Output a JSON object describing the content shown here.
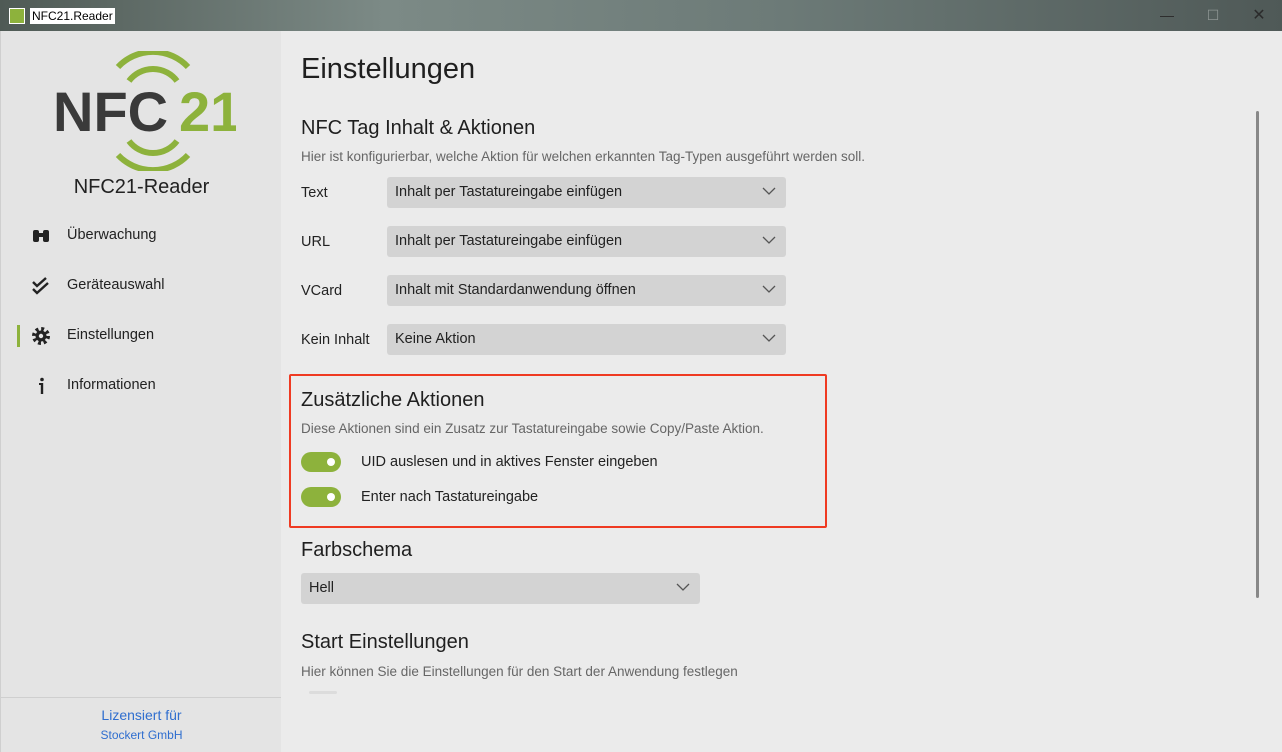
{
  "window": {
    "title": "NFC21.Reader",
    "controls": {
      "minimize": "—",
      "maximize": "☐",
      "close": "✕"
    }
  },
  "sidebar": {
    "logo_text": {
      "nfc": "NFC",
      "num": "21"
    },
    "app_name": "NFC21-Reader",
    "items": [
      {
        "label": "Überwachung",
        "icon": "binoculars-icon",
        "active": false
      },
      {
        "label": "Geräteauswahl",
        "icon": "double-check-icon",
        "active": false
      },
      {
        "label": "Einstellungen",
        "icon": "gear-icon",
        "active": true
      },
      {
        "label": "Informationen",
        "icon": "info-icon",
        "active": false
      }
    ],
    "license_line1": "Lizensiert für",
    "license_line2": "Stockert GmbH"
  },
  "main": {
    "title": "Einstellungen",
    "nfc_section": {
      "title": "NFC Tag Inhalt & Aktionen",
      "description": "Hier ist konfigurierbar, welche Aktion für welchen erkannten Tag-Typen ausgeführt werden soll.",
      "rows": [
        {
          "label": "Text",
          "value": "Inhalt per Tastatureingabe einfügen"
        },
        {
          "label": "URL",
          "value": "Inhalt per Tastatureingabe einfügen"
        },
        {
          "label": "VCard",
          "value": "Inhalt mit Standardanwendung öffnen"
        },
        {
          "label": "Kein Inhalt",
          "value": "Keine Aktion"
        }
      ]
    },
    "extra_section": {
      "title": "Zusätzliche Aktionen",
      "description": "Diese Aktionen sind ein Zusatz zur Tastatureingabe sowie Copy/Paste Aktion.",
      "toggles": [
        {
          "label": "UID auslesen und in aktives Fenster eingeben",
          "on": true
        },
        {
          "label": "Enter nach Tastatureingabe",
          "on": true
        }
      ]
    },
    "color_section": {
      "title": "Farbschema",
      "value": "Hell"
    },
    "start_section": {
      "title": "Start Einstellungen",
      "description": "Hier können Sie die Einstellungen für den Start der Anwendung festlegen"
    }
  },
  "colors": {
    "accent": "#8db23c",
    "highlight_box": "#ef3a22",
    "link": "#2f6ecf"
  }
}
